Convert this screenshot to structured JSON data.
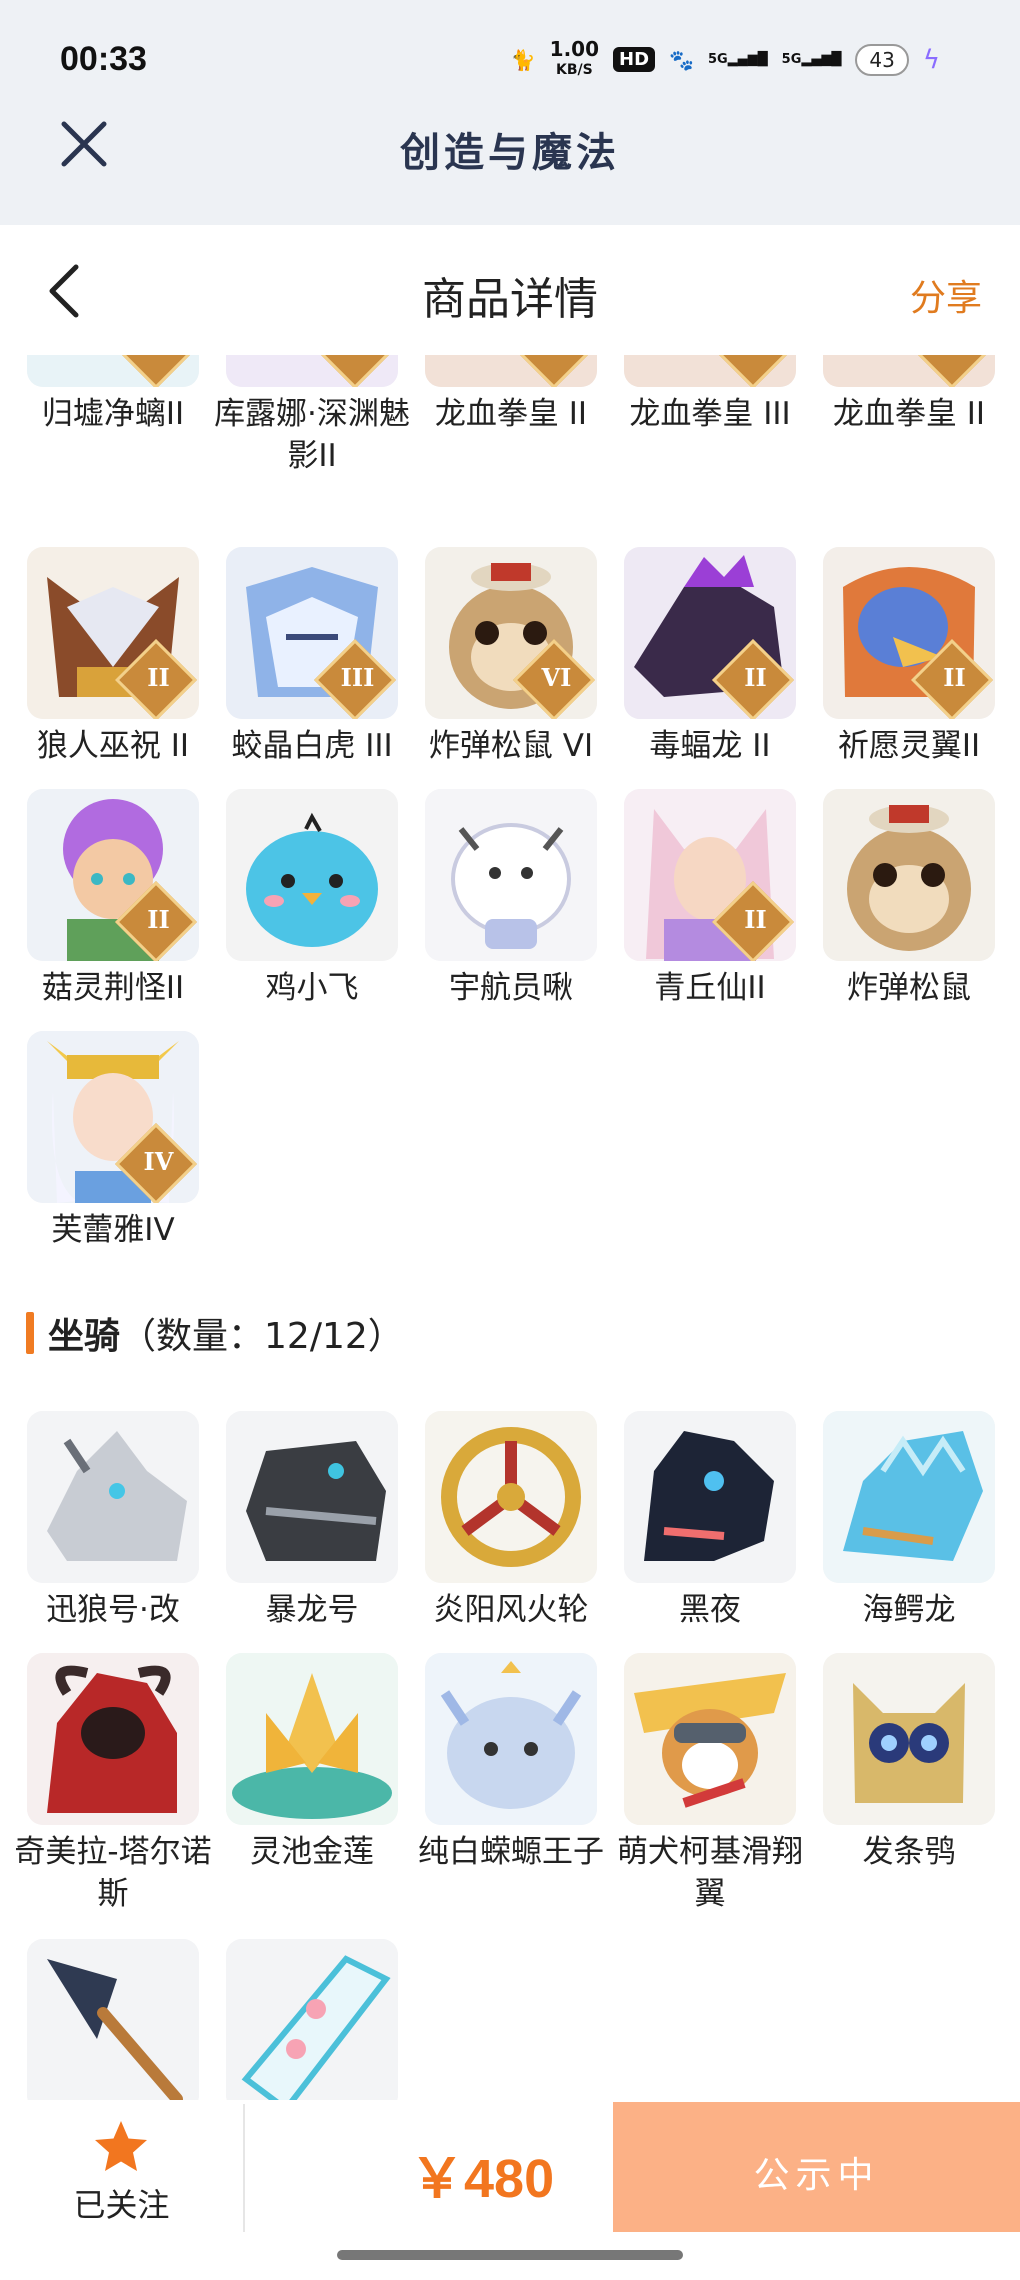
{
  "status_bar": {
    "time": "00:33",
    "net_speed_value": "1.00",
    "net_speed_unit": "KB/S",
    "hd_badge": "HD",
    "signal_label_1": "5G",
    "signal_label_2": "5G",
    "battery_level": "43"
  },
  "app_bar": {
    "title": "创造与魔法"
  },
  "header": {
    "title": "商品详情",
    "share_label": "分享"
  },
  "pets_grid": [
    {
      "name": "归墟净螭II",
      "badge": "II",
      "art": "dragon-cyan"
    },
    {
      "name": "库露娜·深渊魅影II",
      "badge": "II",
      "art": "creature-purple"
    },
    {
      "name": "龙血拳皇 II",
      "badge": "II",
      "art": "monkey-red"
    },
    {
      "name": "龙血拳皇 III",
      "badge": "III",
      "art": "monkey-red"
    },
    {
      "name": "龙血拳皇 II",
      "badge": "II",
      "art": "monkey-red"
    },
    {
      "name": "狼人巫祝 II",
      "badge": "II",
      "art": "wolf"
    },
    {
      "name": "蛟晶白虎 III",
      "badge": "III",
      "art": "tiger"
    },
    {
      "name": "炸弹松鼠 VI",
      "badge": "VI",
      "art": "squirrel"
    },
    {
      "name": "毒蝠龙 II",
      "badge": "II",
      "art": "bat-dragon"
    },
    {
      "name": "祈愿灵翼II",
      "badge": "II",
      "art": "griffin"
    },
    {
      "name": "菇灵荆怪II",
      "badge": "II",
      "art": "elf"
    },
    {
      "name": "鸡小飞",
      "badge": "",
      "art": "bird"
    },
    {
      "name": "宇航员啾",
      "badge": "",
      "art": "astronaut"
    },
    {
      "name": "青丘仙II",
      "badge": "II",
      "art": "fox-girl"
    },
    {
      "name": "炸弹松鼠",
      "badge": "",
      "art": "squirrel"
    },
    {
      "name": "芙蕾雅IV",
      "badge": "IV",
      "art": "valkyrie"
    }
  ],
  "mounts_section": {
    "title": "坐骑",
    "count_label": "（数量：12/12）"
  },
  "mounts_grid": [
    {
      "name": "迅狼号·改",
      "badge": "",
      "art": "mech-wolf"
    },
    {
      "name": "暴龙号",
      "badge": "",
      "art": "mech-rex"
    },
    {
      "name": "炎阳风火轮",
      "badge": "",
      "art": "wheel"
    },
    {
      "name": "黑夜",
      "badge": "",
      "art": "night-dragon"
    },
    {
      "name": "海鳄龙",
      "badge": "",
      "art": "sea-dragon"
    },
    {
      "name": "奇美拉-塔尔诺斯",
      "badge": "",
      "art": "chimera"
    },
    {
      "name": "灵池金莲",
      "badge": "",
      "art": "lotus"
    },
    {
      "name": "纯白蝾螈王子",
      "badge": "",
      "art": "axolotl"
    },
    {
      "name": "萌犬柯基滑翔翼",
      "badge": "",
      "art": "corgi"
    },
    {
      "name": "发条鸮",
      "badge": "",
      "art": "owl"
    },
    {
      "name": "",
      "badge": "",
      "art": "shovel"
    },
    {
      "name": "",
      "badge": "",
      "art": "skateboard"
    }
  ],
  "bottom_bar": {
    "follow_label": "已关注",
    "price": "￥480",
    "status_label": "公示中"
  },
  "colors": {
    "accent": "#f2761f",
    "status_button": "#fcb186",
    "top_bar": "#eef1f5"
  }
}
